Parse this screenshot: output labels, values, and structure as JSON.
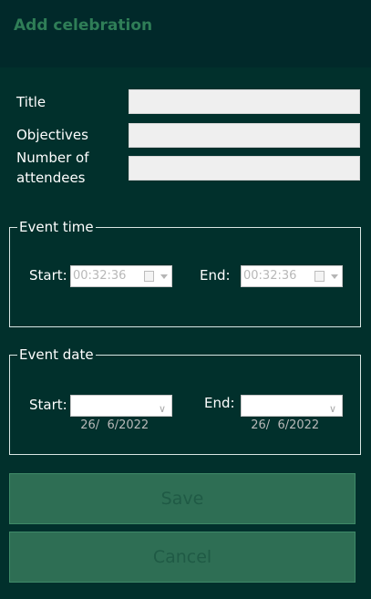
{
  "header": {
    "title": "Add celebration"
  },
  "form": {
    "title_label": "Title",
    "objectives_label": "Objectives",
    "attendees_label_line1": "Number of",
    "attendees_label_line2": "attendees",
    "title_value": "",
    "objectives_value": "",
    "attendees_value": ""
  },
  "event_time": {
    "legend": "Event time",
    "start_label": "Start:",
    "start_value": "00:32:36",
    "end_label": "End:",
    "end_value": "00:32:36"
  },
  "event_date": {
    "legend": "Event date",
    "start_label": "Start:",
    "start_value": "26/  6/2022",
    "end_label": "End:",
    "end_value": "26/  6/2022"
  },
  "buttons": {
    "save": "Save",
    "cancel": "Cancel"
  },
  "icons": {
    "time_picker": "calendar-icon",
    "dropdown": "chevron-down-icon"
  },
  "colors": {
    "background": "#01302c",
    "header": "#01292a",
    "accent": "#2f7e57",
    "button": "#2e6e54"
  }
}
